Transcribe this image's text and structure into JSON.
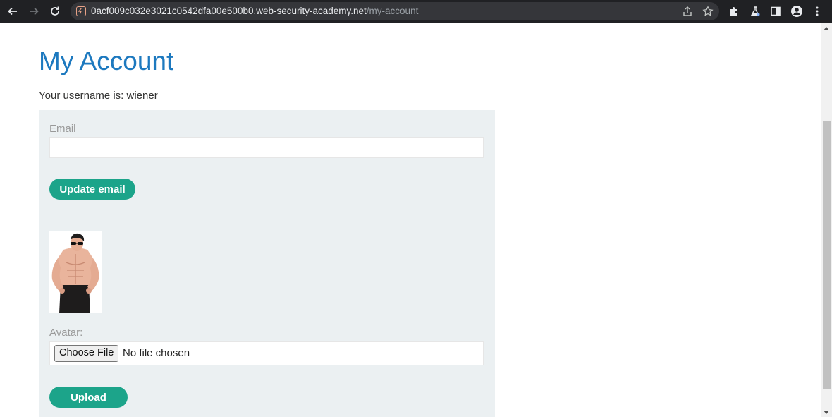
{
  "browser": {
    "url_host": "0acf009c032e3021c0542dfa00e500b0.web-security-academy.net",
    "url_path": "/my-account",
    "icons": [
      "back-arrow-icon",
      "forward-arrow-icon",
      "reload-icon",
      "site-security-icon",
      "share-icon",
      "bookmark-star-icon",
      "extensions-puzzle-icon",
      "labs-flask-icon",
      "side-panel-icon",
      "profile-icon",
      "menu-kebab-icon"
    ]
  },
  "page": {
    "title": "My Account",
    "username_line": "Your username is: wiener"
  },
  "email_form": {
    "label": "Email",
    "value": "",
    "button_label": "Update email"
  },
  "avatar_form": {
    "label": "Avatar:",
    "choose_file_label": "Choose File",
    "file_status": "No file chosen",
    "button_label": "Upload"
  },
  "colors": {
    "title": "#1d79bf",
    "button": "#1ca48a",
    "panel_bg": "#ebf0f2",
    "label": "#999999",
    "chrome_bg": "#202124"
  }
}
